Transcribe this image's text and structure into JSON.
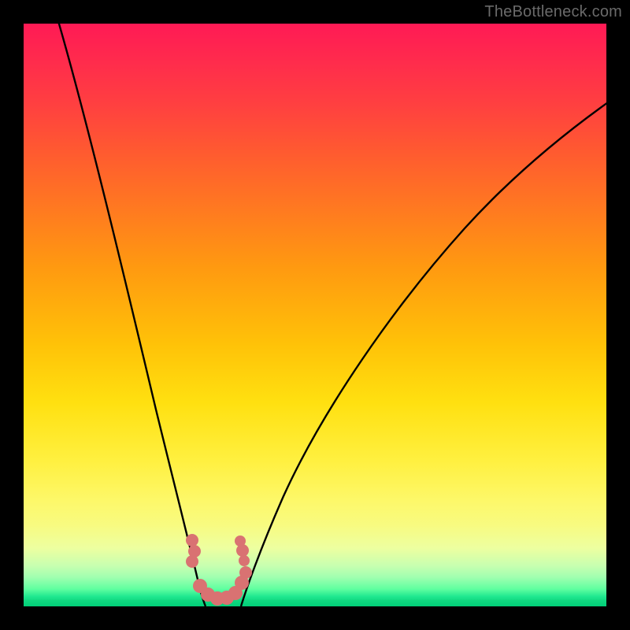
{
  "watermark": "TheBottleneck.com",
  "chart_data": {
    "type": "line",
    "title": "",
    "xlabel": "",
    "ylabel": "",
    "xlim": [
      0,
      100
    ],
    "ylim": [
      0,
      100
    ],
    "grid": false,
    "legend": false,
    "background": {
      "type": "vertical-gradient",
      "stops": [
        {
          "pos": 0,
          "color": "#ff1a55"
        },
        {
          "pos": 50,
          "color": "#ffb010"
        },
        {
          "pos": 80,
          "color": "#fff040"
        },
        {
          "pos": 100,
          "color": "#00cf78"
        }
      ]
    },
    "series": [
      {
        "name": "left-branch",
        "color": "#000000",
        "x": [
          5,
          8,
          11,
          14,
          17,
          20,
          23,
          25,
          27,
          28.5,
          29.5,
          30.5
        ],
        "y": [
          100,
          88,
          76,
          64,
          53,
          42,
          32,
          24,
          16,
          10,
          6,
          2
        ]
      },
      {
        "name": "right-branch",
        "color": "#000000",
        "x": [
          37,
          39,
          42,
          46,
          51,
          57,
          64,
          72,
          81,
          90,
          100
        ],
        "y": [
          2,
          6,
          12,
          20,
          29,
          38,
          48,
          57,
          66,
          74,
          81
        ]
      },
      {
        "name": "valley-markers",
        "color": "#d86a6a",
        "type": "scatter",
        "x": [
          28.8,
          29.4,
          30.2,
          31.2,
          32.4,
          33.6,
          34.8,
          35.8,
          36.6,
          37.2
        ],
        "y": [
          11.5,
          8.0,
          4.8,
          2.8,
          1.8,
          1.8,
          2.6,
          4.2,
          6.5,
          9.5
        ]
      }
    ]
  }
}
